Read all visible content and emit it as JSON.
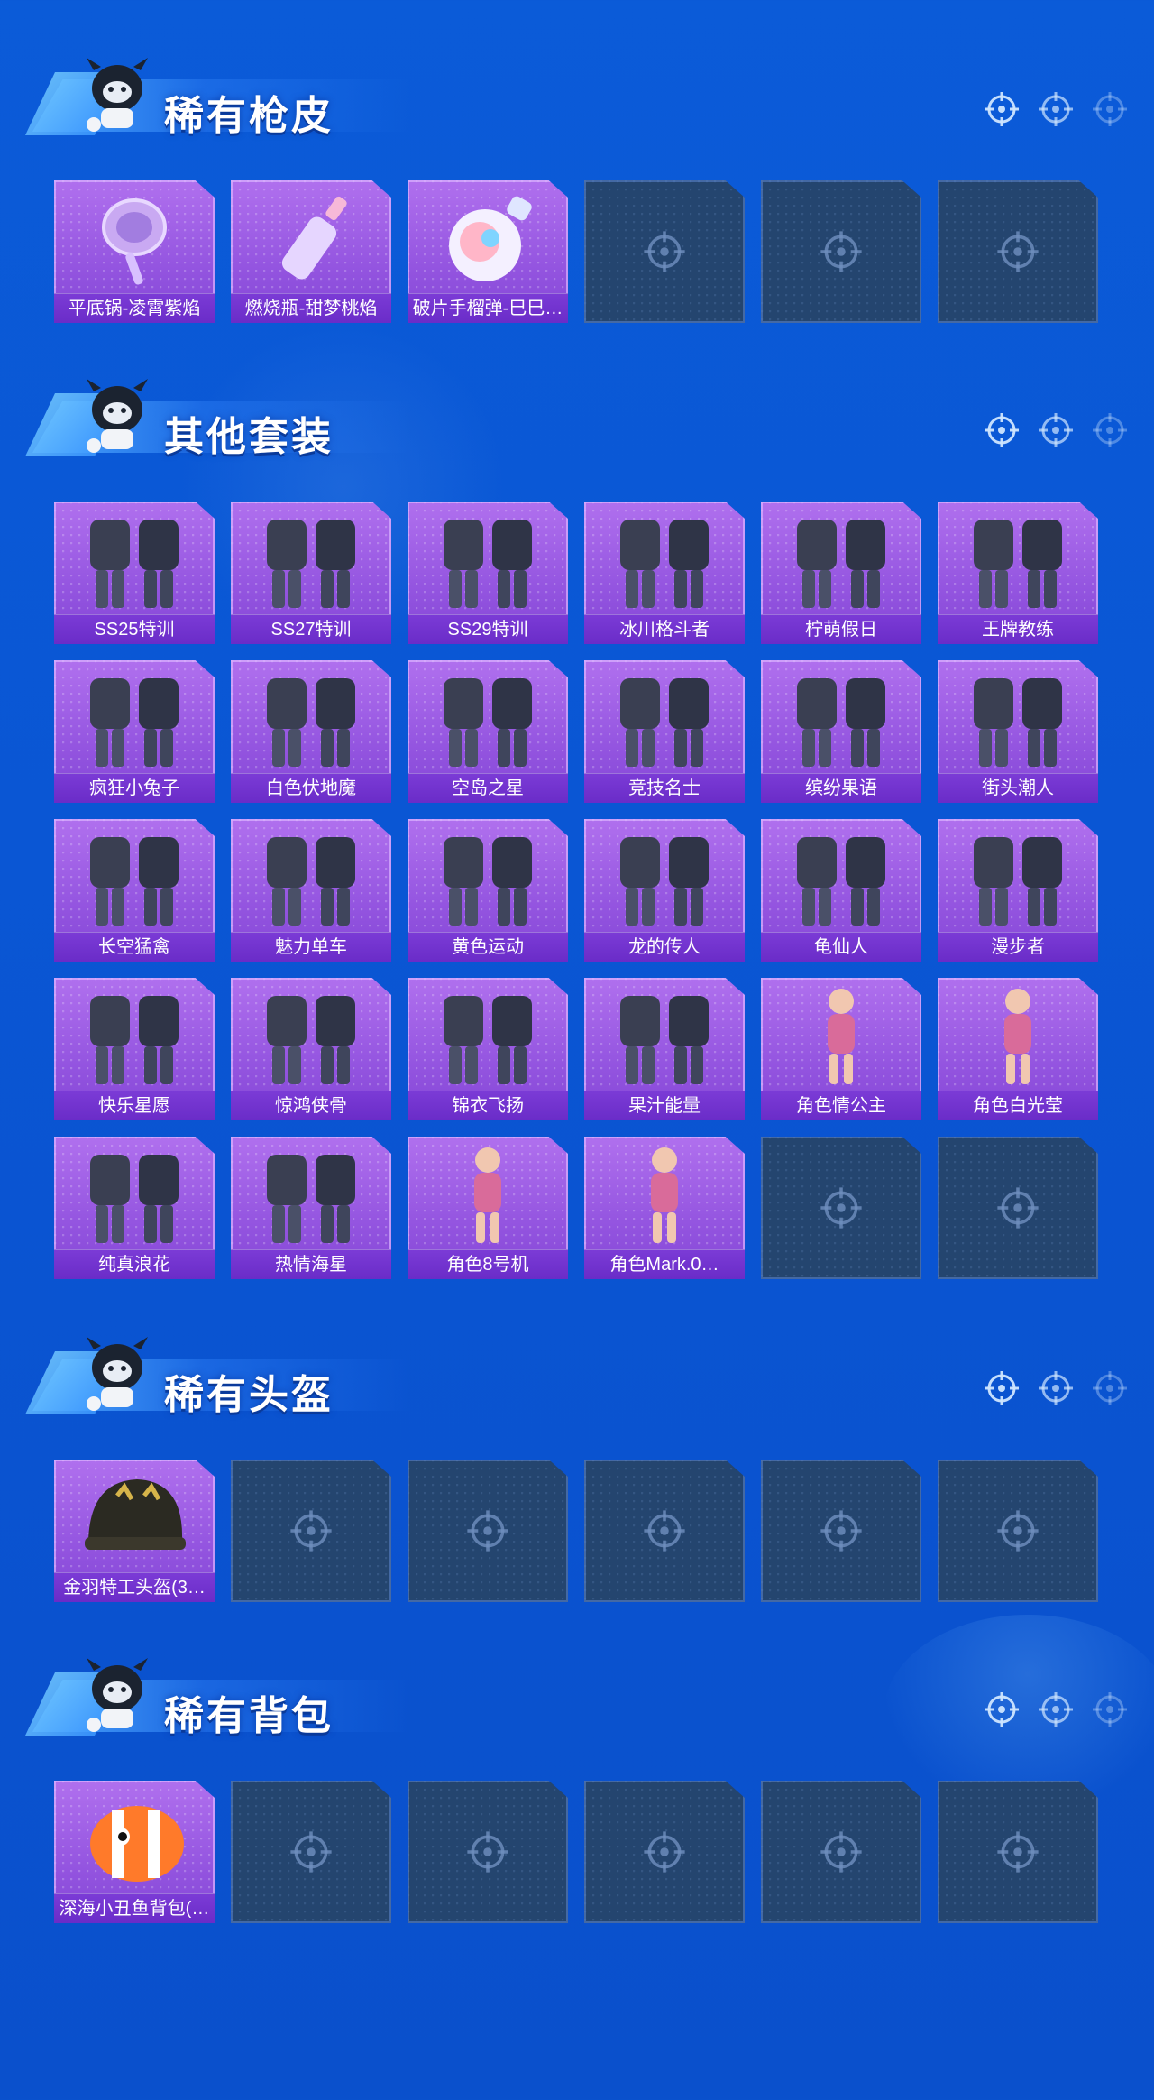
{
  "colors": {
    "background": "#0a56d4",
    "card_filled": "#9455e0",
    "card_label": "#6a2cc8",
    "card_empty": "#24456f"
  },
  "sections": [
    {
      "title": "稀有枪皮",
      "items": [
        {
          "label": "平底锅-凌霄紫焰",
          "icon": "pan-icon"
        },
        {
          "label": "燃烧瓶-甜梦桃焰",
          "icon": "bottle-icon"
        },
        {
          "label": "破片手榴弹-巳巳…",
          "icon": "grenade-icon"
        },
        null,
        null,
        null
      ]
    },
    {
      "title": "其他套装",
      "items": [
        {
          "label": "SS25特训",
          "icon": "outfit-icon"
        },
        {
          "label": "SS27特训",
          "icon": "outfit-icon"
        },
        {
          "label": "SS29特训",
          "icon": "outfit-icon"
        },
        {
          "label": "冰川格斗者",
          "icon": "outfit-icon"
        },
        {
          "label": "柠萌假日",
          "icon": "outfit-icon"
        },
        {
          "label": "王牌教练",
          "icon": "outfit-icon"
        },
        {
          "label": "疯狂小兔子",
          "icon": "outfit-icon"
        },
        {
          "label": "白色伏地魔",
          "icon": "outfit-icon"
        },
        {
          "label": "空岛之星",
          "icon": "outfit-icon"
        },
        {
          "label": "竞技名士",
          "icon": "outfit-icon"
        },
        {
          "label": "缤纷果语",
          "icon": "outfit-icon"
        },
        {
          "label": "街头潮人",
          "icon": "outfit-icon"
        },
        {
          "label": "长空猛禽",
          "icon": "outfit-icon"
        },
        {
          "label": "魅力单车",
          "icon": "outfit-icon"
        },
        {
          "label": "黄色运动",
          "icon": "outfit-icon"
        },
        {
          "label": "龙的传人",
          "icon": "outfit-icon"
        },
        {
          "label": "龟仙人",
          "icon": "outfit-icon"
        },
        {
          "label": "漫步者",
          "icon": "outfit-icon"
        },
        {
          "label": "快乐星愿",
          "icon": "outfit-icon"
        },
        {
          "label": "惊鸿侠骨",
          "icon": "outfit-icon"
        },
        {
          "label": "锦衣飞扬",
          "icon": "outfit-icon"
        },
        {
          "label": "果汁能量",
          "icon": "outfit-icon"
        },
        {
          "label": "角色情公主",
          "icon": "character-icon"
        },
        {
          "label": "角色白光莹",
          "icon": "character-icon"
        },
        {
          "label": "纯真浪花",
          "icon": "outfit-icon"
        },
        {
          "label": "热情海星",
          "icon": "outfit-icon"
        },
        {
          "label": "角色8号机",
          "icon": "character-icon"
        },
        {
          "label": "角色Mark.0…",
          "icon": "character-icon"
        },
        null,
        null
      ]
    },
    {
      "title": "稀有头盔",
      "items": [
        {
          "label": "金羽特工头盔(3…",
          "icon": "helmet-icon"
        },
        null,
        null,
        null,
        null,
        null
      ]
    },
    {
      "title": "稀有背包",
      "items": [
        {
          "label": "深海小丑鱼背包(…",
          "icon": "backpack-icon"
        },
        null,
        null,
        null,
        null,
        null
      ]
    }
  ]
}
